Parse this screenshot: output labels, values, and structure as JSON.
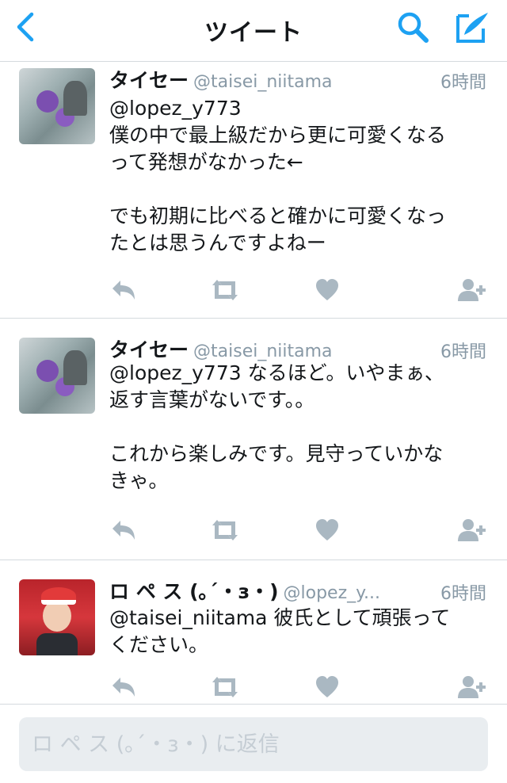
{
  "nav": {
    "title": "ツイート",
    "back_icon": "chevron-left-icon",
    "search_icon": "search-icon",
    "compose_icon": "compose-tweet-icon",
    "accent": "#1da1f2"
  },
  "tweets": [
    {
      "name": "タイセー",
      "handle": "@taisei_niitama",
      "time": "6時間",
      "text": "@lopez_y773\n僕の中で最上級だから更に可愛くなる\nって発想がなかった←\n\nでも初期に比べると確かに可愛くなっ\nたとは思うんですよねー"
    },
    {
      "name": "タイセー",
      "handle": "@taisei_niitama",
      "time": "6時間",
      "text": "@lopez_y773 なるほど。いやまぁ、\n返す言葉がないです。。\n\nこれから楽しみです。見守っていかな\nきゃ。"
    },
    {
      "name": "ロ ペ ス (｡´・з・)",
      "handle": "@lopez_y...",
      "time": "6時間",
      "text": "@taisei_niitama 彼氏として頑張って\nください。"
    }
  ],
  "actions": {
    "reply_icon": "reply-icon",
    "retweet_icon": "retweet-icon",
    "like_icon": "heart-icon",
    "follow_icon": "follow-user-icon",
    "icon_color": "#aab8c2"
  },
  "reply": {
    "placeholder": "ロ ペ ス (｡´・з・) に返信"
  }
}
